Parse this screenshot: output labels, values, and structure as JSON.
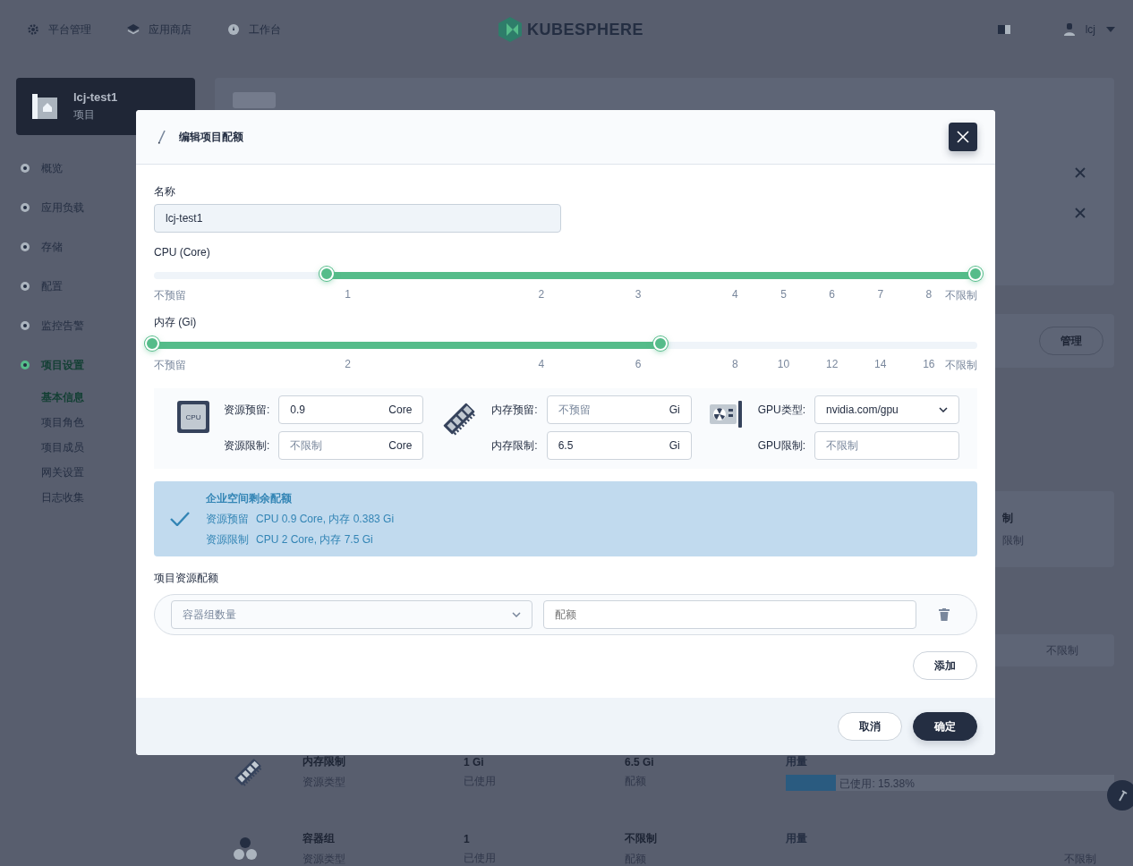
{
  "top_nav": {
    "items": [
      {
        "label": "平台管理",
        "kind": "gear"
      },
      {
        "label": "应用商店",
        "kind": "layers"
      },
      {
        "label": "工作台",
        "kind": "dial"
      }
    ],
    "logo": "KUBESPHERE",
    "user": "lcj"
  },
  "sidebar": {
    "project": {
      "name": "lcj-test1",
      "type": "项目"
    },
    "items": [
      {
        "label": "概览",
        "selected": false
      },
      {
        "label": "应用负载",
        "selected": false
      },
      {
        "label": "存储",
        "selected": false
      },
      {
        "label": "配置",
        "selected": false
      },
      {
        "label": "监控告警",
        "selected": false
      },
      {
        "label": "项目设置",
        "selected": true,
        "children": [
          {
            "label": "基本信息",
            "selected": true
          },
          {
            "label": "项目角色",
            "selected": false
          },
          {
            "label": "项目成员",
            "selected": false
          },
          {
            "label": "网关设置",
            "selected": false
          },
          {
            "label": "日志收集",
            "selected": false
          }
        ]
      }
    ]
  },
  "page": {
    "action": "管理",
    "fragments": [
      "制",
      "限制"
    ],
    "unlimited": "不限制",
    "quota_rows": [
      {
        "kind": "memory",
        "name": "内存限制",
        "name_caption": "资源类型",
        "used": "1 Gi",
        "used_caption": "已使用",
        "quota": "6.5 Gi",
        "quota_caption": "配额",
        "usage_label": "用量",
        "usage": {
          "level": 0.1538,
          "text": "已使用: 15.38%"
        }
      },
      {
        "kind": "pod",
        "name": "容器组",
        "name_caption": "资源类型",
        "used": "1",
        "used_caption": "已使用",
        "quota": "不限制",
        "quota_caption": "配额",
        "usage_label": "用量",
        "usage": {
          "text": "不限制"
        }
      }
    ]
  },
  "dialog": {
    "title": "编辑项目配额",
    "name_label": "名称",
    "name_value": "lcj-test1",
    "sliders": [
      {
        "label": "CPU (Core)",
        "thumbs": [
          {
            "level": 0.212
          },
          {
            "level": 1
          }
        ],
        "marks": [
          "不预留",
          "1",
          "2",
          "3",
          "4",
          "5",
          "6",
          "7",
          "8",
          "不限制"
        ]
      },
      {
        "label": "内存 (Gi)",
        "thumbs": [
          {
            "level": 0
          },
          {
            "level": 0.617
          }
        ],
        "marks": [
          "不预留",
          "2",
          "4",
          "6",
          "8",
          "10",
          "12",
          "14",
          "16",
          "不限制"
        ]
      }
    ],
    "resources": [
      {
        "kind": "cpu",
        "icon_text": "CPU",
        "fields": [
          {
            "kind": "input",
            "label": "资源预留:",
            "value": "0.9",
            "unit": "Core"
          },
          {
            "kind": "input",
            "label": "资源限制:",
            "placeholder": "不限制",
            "unit": "Core"
          }
        ]
      },
      {
        "kind": "memory",
        "fields": [
          {
            "kind": "input",
            "label": "内存预留:",
            "placeholder": "不预留",
            "unit": "Gi"
          },
          {
            "kind": "input",
            "label": "内存限制:",
            "value": "6.5",
            "unit": "Gi"
          }
        ]
      },
      {
        "kind": "gpu",
        "fields": [
          {
            "kind": "select",
            "label": "GPU类型:",
            "value": "nvidia.com/gpu"
          },
          {
            "kind": "input",
            "label": "GPU限制:",
            "placeholder": "不限制"
          }
        ]
      }
    ],
    "notice": {
      "title": "企业空间剩余配额",
      "lines": [
        {
          "label": "资源预留",
          "text": "CPU 0.9 Core, 内存 0.383 Gi"
        },
        {
          "label": "资源限制",
          "text": "CPU 2 Core, 内存 7.5 Gi"
        }
      ]
    },
    "quota_section": {
      "label": "项目资源配额",
      "select_placeholder": "容器组数量",
      "input_placeholder": "配额",
      "add": "添加"
    },
    "buttons": [
      {
        "label": "取消",
        "kind": "secondary"
      },
      {
        "label": "确定",
        "kind": "primary"
      }
    ]
  }
}
